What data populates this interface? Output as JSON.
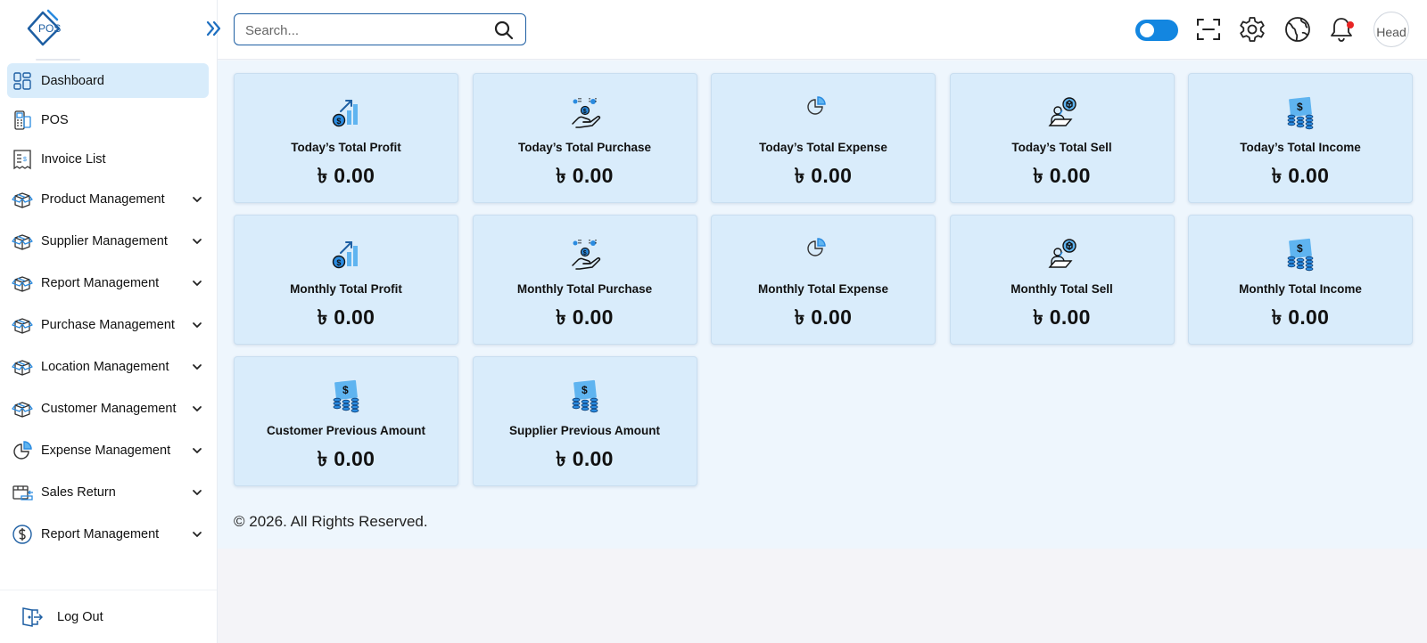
{
  "brand": {
    "logo_text": "POS"
  },
  "sidebar": {
    "items": [
      {
        "label": "Dashboard",
        "icon": "dashboard-icon",
        "active": true
      },
      {
        "label": "POS",
        "icon": "pos-icon"
      },
      {
        "label": "Invoice List",
        "icon": "invoice-icon"
      },
      {
        "label": "Product Management",
        "icon": "box-icon",
        "expandable": true
      },
      {
        "label": "Supplier Management",
        "icon": "box-icon",
        "expandable": true
      },
      {
        "label": "Report Management",
        "icon": "box-icon",
        "expandable": true
      },
      {
        "label": "Purchase Management",
        "icon": "box-icon",
        "expandable": true
      },
      {
        "label": "Location Management",
        "icon": "box-icon",
        "expandable": true
      },
      {
        "label": "Customer Management",
        "icon": "box-icon",
        "expandable": true
      },
      {
        "label": "Expense Management",
        "icon": "pie-icon",
        "expandable": true
      },
      {
        "label": "Sales Return",
        "icon": "return-icon",
        "expandable": true
      },
      {
        "label": "Report Management",
        "icon": "dollar-circle-icon",
        "expandable": true
      }
    ],
    "logout_label": "Log Out"
  },
  "header": {
    "search_placeholder": "Search...",
    "avatar_alt": "Head",
    "accent": "#1386e0"
  },
  "cards": [
    {
      "title": "Today’s Total Profit",
      "value": "৳ 0.00",
      "icon": "profit-chart-icon"
    },
    {
      "title": "Today’s Total Purchase",
      "value": "৳ 0.00",
      "icon": "hand-coins-icon"
    },
    {
      "title": "Today’s Total Expense",
      "value": "৳ 0.00",
      "icon": "pie-icon"
    },
    {
      "title": "Today’s Total Sell",
      "value": "৳ 0.00",
      "icon": "seller-icon"
    },
    {
      "title": "Today’s Total Income",
      "value": "৳ 0.00",
      "icon": "money-stack-icon"
    },
    {
      "title": "Monthly Total Profit",
      "value": "৳ 0.00",
      "icon": "profit-chart-icon"
    },
    {
      "title": "Monthly Total Purchase",
      "value": "৳ 0.00",
      "icon": "hand-coins-icon"
    },
    {
      "title": "Monthly Total Expense",
      "value": "৳ 0.00",
      "icon": "pie-icon"
    },
    {
      "title": "Monthly Total Sell",
      "value": "৳ 0.00",
      "icon": "seller-icon"
    },
    {
      "title": "Monthly Total Income",
      "value": "৳ 0.00",
      "icon": "money-stack-icon"
    },
    {
      "title": "Customer Previous Amount",
      "value": "৳ 0.00",
      "icon": "money-stack-icon"
    },
    {
      "title": "Supplier Previous Amount",
      "value": "৳ 0.00",
      "icon": "money-stack-icon"
    }
  ],
  "footer": {
    "copyright": "© 2026. All Rights Reserved."
  }
}
